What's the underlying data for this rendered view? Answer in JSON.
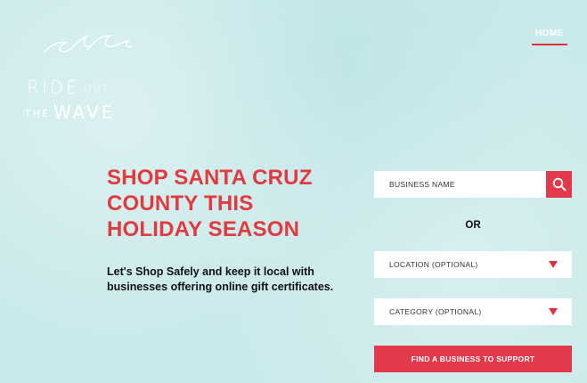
{
  "brand": {
    "line1_main": "RIDE",
    "line1_small": "OUT",
    "line2_small": "THE",
    "line2_main": "WAVE"
  },
  "nav": {
    "home_label": "HOME"
  },
  "hero": {
    "headline_lines": [
      "SHOP SANTA CRUZ",
      "COUNTY THIS",
      "HOLIDAY SEASON"
    ],
    "subtext_lines": [
      "Let's Shop Safely and keep it local with",
      "businesses offering online gift certificates."
    ]
  },
  "search": {
    "placeholder": "BUSINESS NAME",
    "or_label": "OR",
    "location_select": "LOCATION (OPTIONAL)",
    "category_select": "CATEGORY (OPTIONAL)",
    "submit_label": "FIND A BUSINESS TO SUPPORT"
  },
  "colors": {
    "accent": "#e23a4a",
    "background": "#c9e9ea",
    "headline": "#e23a3e"
  }
}
